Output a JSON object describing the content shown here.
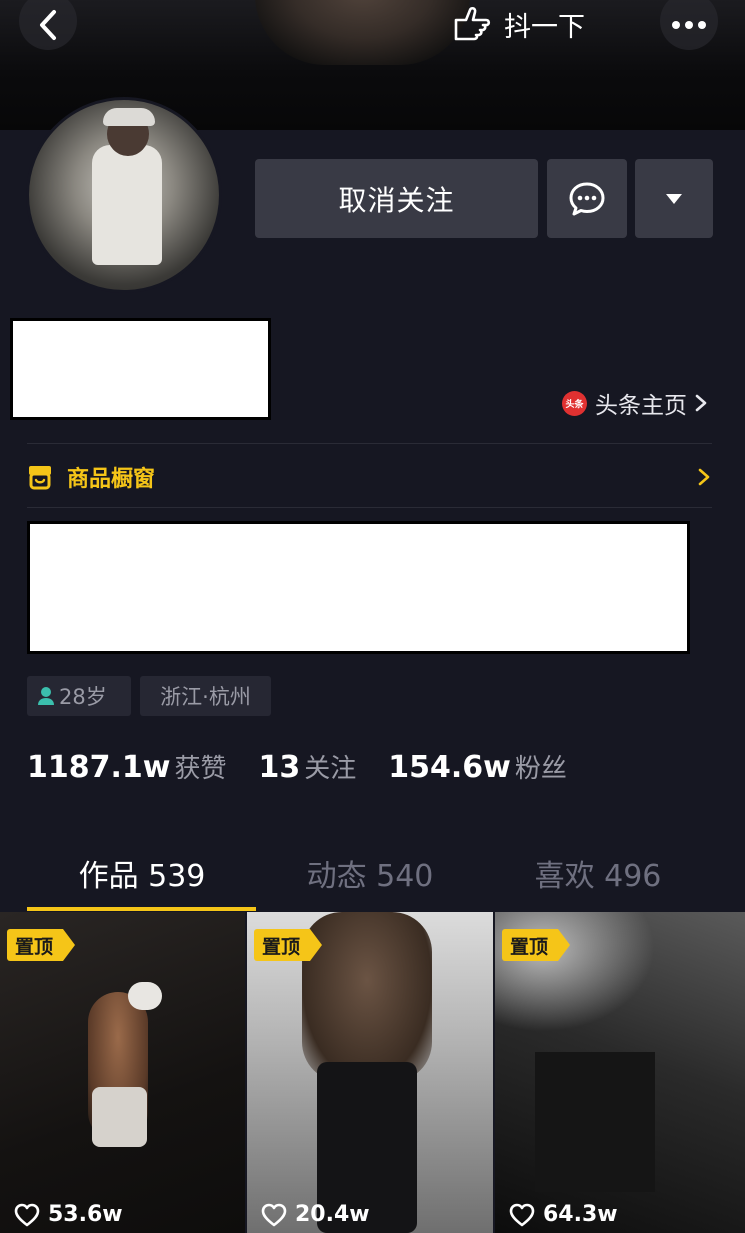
{
  "header": {
    "shake_label": "抖一下"
  },
  "profile": {
    "unfollow_label": "取消关注",
    "toutiao_badge": "头条",
    "toutiao_label": "头条主页",
    "shop_label": "商品橱窗",
    "age": "28岁",
    "location": "浙江·杭州"
  },
  "stats": [
    {
      "num": "1187.1w",
      "label": "获赞"
    },
    {
      "num": "13",
      "label": "关注"
    },
    {
      "num": "154.6w",
      "label": "粉丝"
    }
  ],
  "tabs": [
    {
      "label": "作品 539",
      "active": true
    },
    {
      "label": "动态 540",
      "active": false
    },
    {
      "label": "喜欢 496",
      "active": false
    }
  ],
  "posts": [
    {
      "pin": "置顶",
      "likes": "53.6w"
    },
    {
      "pin": "置顶",
      "likes": "20.4w"
    },
    {
      "pin": "置顶",
      "likes": "64.3w"
    }
  ],
  "colors": {
    "background": "#161722",
    "accent": "#f5c518",
    "button": "#393a45"
  }
}
